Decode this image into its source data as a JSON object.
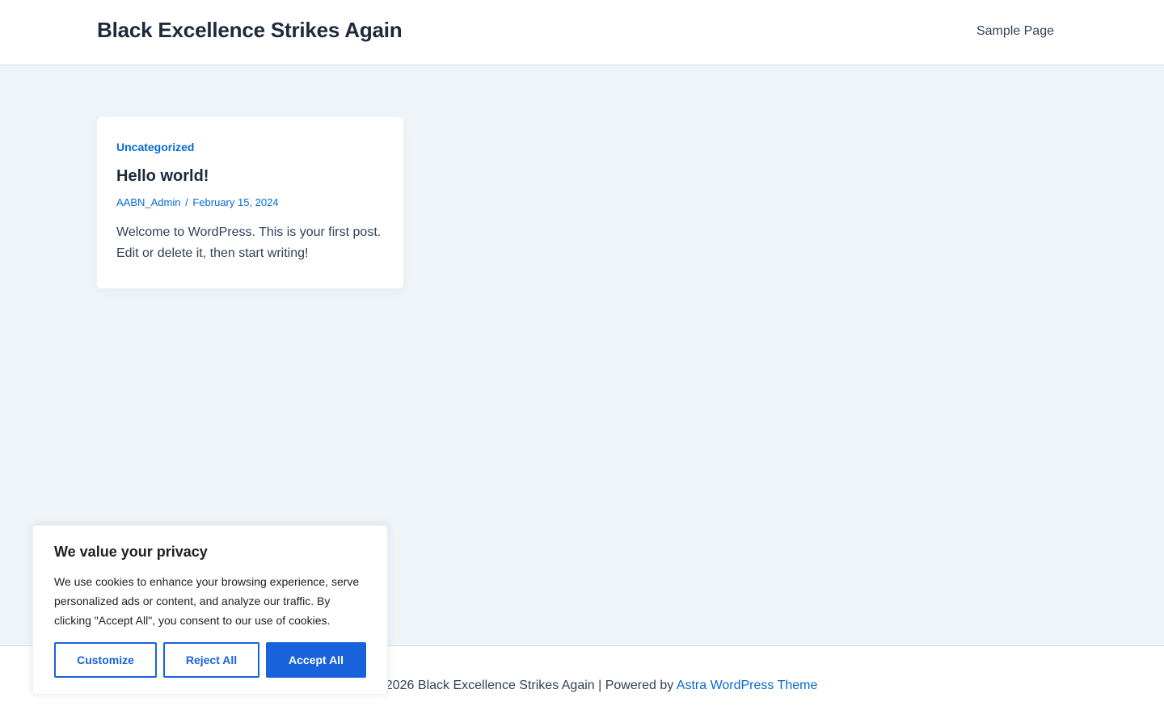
{
  "header": {
    "site_title": "Black Excellence Strikes Again",
    "nav": [
      {
        "label": "Sample Page"
      }
    ]
  },
  "post": {
    "category": "Uncategorized",
    "title": "Hello world!",
    "author": "AABN_Admin",
    "separator": "/",
    "date": "February 15, 2024",
    "excerpt": "Welcome to WordPress. This is your first post. Edit or delete it, then start writing!"
  },
  "footer": {
    "copyright": "© 2026 Black Excellence Strikes Again | Powered by",
    "theme_link": "Astra WordPress Theme"
  },
  "cookie_banner": {
    "title": "We value your privacy",
    "text": "We use cookies to enhance your browsing experience, serve personalized ads or content, and analyze our traffic. By clicking \"Accept All\", you consent to our use of cookies.",
    "customize_label": "Customize",
    "reject_label": "Reject All",
    "accept_label": "Accept All"
  },
  "colors": {
    "accent": "#046bd2",
    "cookie_accent": "#1863dc",
    "background": "#eff4f9",
    "heading": "#1e293b"
  }
}
